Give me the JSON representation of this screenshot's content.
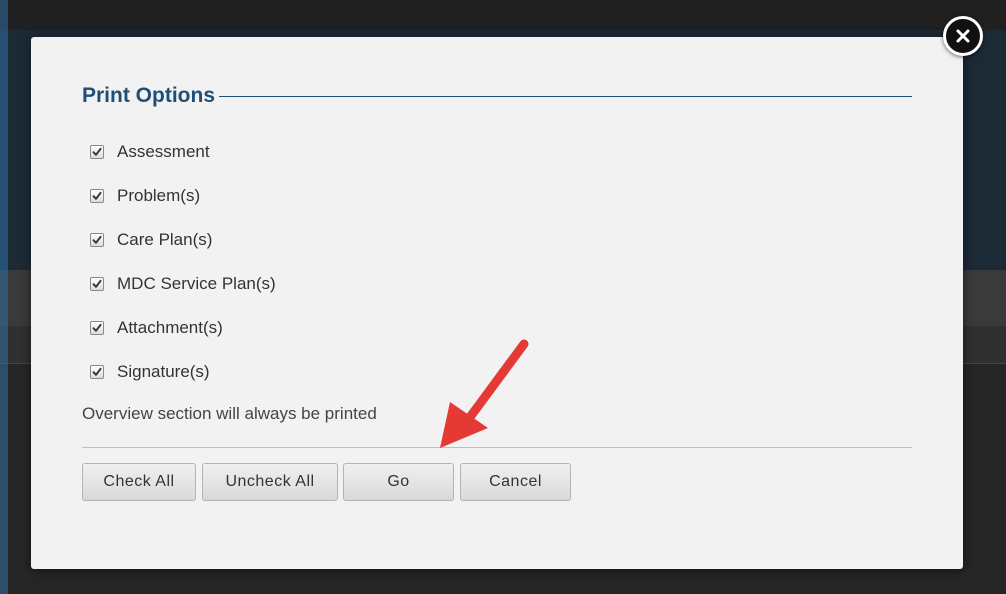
{
  "dialog": {
    "title": "Print Options",
    "note": "Overview section will always be printed"
  },
  "options": [
    {
      "label": "Assessment",
      "checked": true
    },
    {
      "label": "Problem(s)",
      "checked": true
    },
    {
      "label": "Care Plan(s)",
      "checked": true
    },
    {
      "label": "MDC Service Plan(s)",
      "checked": true
    },
    {
      "label": "Attachment(s)",
      "checked": true
    },
    {
      "label": "Signature(s)",
      "checked": true
    }
  ],
  "buttons": {
    "check_all": "Check All",
    "uncheck_all": "Uncheck All",
    "go": "Go",
    "cancel": "Cancel"
  },
  "icons": {
    "close": "close-icon",
    "checkbox_checked": "checkmark-icon",
    "annotation_arrow": "arrow-icon"
  },
  "colors": {
    "title": "#1f4e79",
    "annotation_arrow": "#e53935",
    "modal_bg": "#f2f2f2"
  }
}
